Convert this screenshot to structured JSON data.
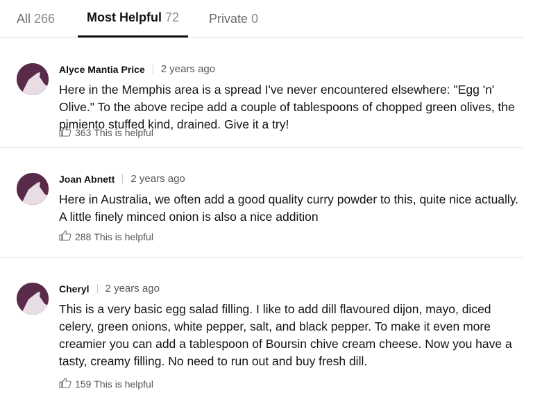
{
  "tabs": [
    {
      "label": "All",
      "count": "266"
    },
    {
      "label": "Most Helpful",
      "count": "72"
    },
    {
      "label": "Private",
      "count": "0"
    }
  ],
  "comments": [
    {
      "author": "Alyce Mantia Price",
      "time": "2 years ago",
      "text": "Here in the Memphis area is a spread I've never encountered elsewhere: \"Egg 'n' Olive.\" To the above recipe add a couple of tablespoons of chopped green olives, the pimiento stuffed kind, drained. Give it a try!",
      "helpful_count": "363",
      "helpful_label": "This is helpful"
    },
    {
      "author": "Joan Abnett",
      "time": "2 years ago",
      "text": "Here in Australia, we often add a good quality curry powder to this, quite nice actually. A little finely minced onion is also a nice addition",
      "helpful_count": "288",
      "helpful_label": "This is helpful"
    },
    {
      "author": "Cheryl",
      "time": "2 years ago",
      "text": "This is a very basic egg salad filling. I like to add dill flavoured dijon, mayo, diced celery, green onions, white pepper, salt, and black pepper. To make it even more creamier you can add a tablespoon of Boursin chive cream cheese. Now you have a tasty, creamy filling. No need to run out and buy fresh dill.",
      "helpful_count": "159",
      "helpful_label": "This is helpful"
    }
  ],
  "colors": {
    "avatar_dark": "#5a2a4a",
    "avatar_light": "#e8dde4"
  },
  "icons": {
    "avatar": "user-avatar-icon",
    "helpful": "thumbs-up-icon"
  }
}
